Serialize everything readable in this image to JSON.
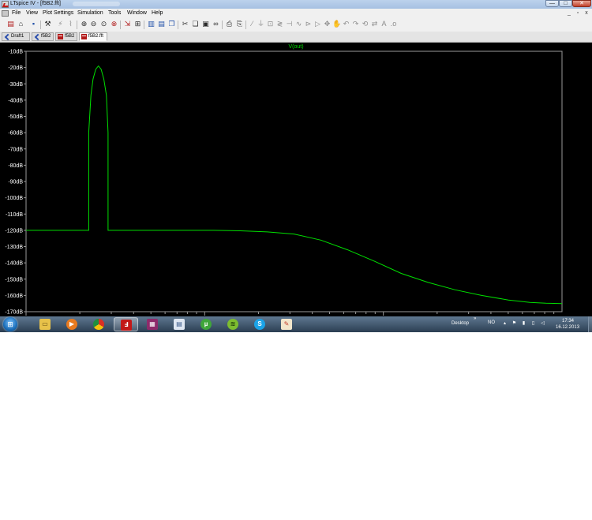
{
  "window": {
    "title": "LTspice IV - [f5B2.fft]",
    "caption_buttons": [
      "—",
      "□",
      "✕"
    ]
  },
  "menu": {
    "items": [
      "File",
      "View",
      "Plot Settings",
      "Simulation",
      "Tools",
      "Window",
      "Help"
    ],
    "mdi_buttons": [
      "_",
      "▫",
      "x"
    ]
  },
  "toolbar": {
    "icons": [
      "new-schematic-icon",
      "open-icon",
      "save-icon",
      "hammer-icon",
      "run-icon",
      "probe-icon",
      "zoom-in-icon",
      "zoom-out-icon",
      "zoom-fit-icon",
      "cancel-zoom-icon",
      "autorange-icon",
      "plot-pane-icon",
      "tile-vertical-icon",
      "tile-horizontal-icon",
      "cascade-icon",
      "cut-icon",
      "copy-icon",
      "paste-icon",
      "find-icon",
      "print-icon",
      "print-preview-icon",
      "wire-icon",
      "ground-icon",
      "label-icon",
      "resistor-icon",
      "capacitor-icon",
      "inductor-icon",
      "diode-icon",
      "component-icon",
      "move-icon",
      "drag-icon",
      "undo-icon",
      "redo-icon",
      "rotate-icon",
      "mirror-icon",
      "text-icon",
      "spice-directive-icon"
    ]
  },
  "tabs": [
    {
      "label": "Draft1",
      "icon": "schematic-icon",
      "active": false
    },
    {
      "label": "f5B2",
      "icon": "schematic-icon",
      "active": false
    },
    {
      "label": "f5B2",
      "icon": "waveform-icon",
      "active": false
    },
    {
      "label": "f5B2.fft",
      "icon": "waveform-icon",
      "active": true
    }
  ],
  "taskbar": {
    "apps": [
      "explorer-icon",
      "media-player-icon",
      "chrome-icon",
      "ltspice-icon",
      "winrar-icon",
      "document-icon",
      "utorrent-icon",
      "spotify-icon",
      "skype-icon",
      "paint-icon"
    ],
    "desktop_label": "Desktop",
    "chevron": "»",
    "language": "NO",
    "time": "17:34",
    "date": "16.12.2013"
  },
  "colors": {
    "plot_background": "#000000",
    "trace": "#00e000",
    "axis_text": "#ffffff"
  },
  "chart_data": {
    "type": "line",
    "title": "V(out)",
    "xlabel": "",
    "ylabel": "",
    "y_unit": "dB",
    "ylim": [
      -170,
      -10
    ],
    "yticks": [
      -10,
      -20,
      -30,
      -40,
      -50,
      -60,
      -70,
      -80,
      -90,
      -100,
      -110,
      -120,
      -130,
      -140,
      -150,
      -160,
      -170
    ],
    "ytick_labels": [
      "-10dB",
      "-20dB",
      "-30dB",
      "-40dB",
      "-50dB",
      "-60dB",
      "-70dB",
      "-80dB",
      "-90dB",
      "-100dB",
      "-110dB",
      "-120dB",
      "-130dB",
      "-140dB",
      "-150dB",
      "-160dB",
      "-170dB"
    ],
    "x_scale": "log",
    "x_tick_labels_visible": false,
    "xlim": [
      0,
      1
    ],
    "grid": false,
    "series": [
      {
        "name": "V(out)",
        "x": [
          0.0,
          0.117,
          0.117,
          0.121,
          0.125,
          0.13,
          0.135,
          0.14,
          0.145,
          0.15,
          0.153,
          0.153,
          0.25,
          0.35,
          0.4,
          0.45,
          0.5,
          0.55,
          0.6,
          0.65,
          0.7,
          0.75,
          0.8,
          0.85,
          0.9,
          0.94,
          0.97,
          1.0
        ],
        "y": [
          -120,
          -120,
          -60,
          -37,
          -27,
          -21,
          -19,
          -21,
          -27,
          -37,
          -60,
          -120,
          -120,
          -120,
          -120.3,
          -121,
          -122.3,
          -126,
          -132,
          -139,
          -146.5,
          -152,
          -156.5,
          -160,
          -162.8,
          -164.3,
          -164.8,
          -165
        ]
      }
    ]
  }
}
